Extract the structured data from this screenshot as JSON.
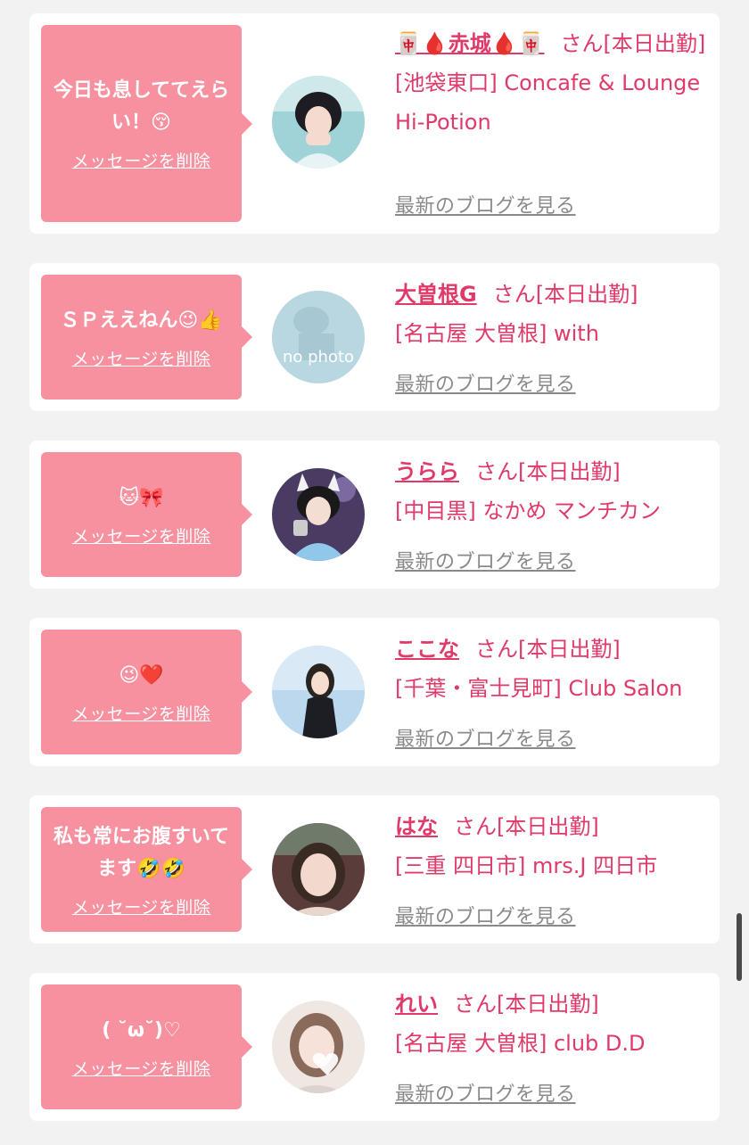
{
  "entries": [
    {
      "message": "今日も息しててえらい！😚",
      "delete_label": "メッセージを削除",
      "name": "🀄🩸赤城🩸🀄",
      "san": "さん",
      "status": "[本日出勤]",
      "shop": "[池袋東口] Concafe & Lounge Hi-Potion",
      "blog_label": "最新のブログを見る"
    },
    {
      "message": "ＳＰええねん😉👍",
      "delete_label": "メッセージを削除",
      "name": "大曽根G",
      "san": "さん",
      "status": "[本日出勤]",
      "shop": "[名古屋 大曽根] with",
      "blog_label": "最新のブログを見る",
      "avatar_text": "no photo"
    },
    {
      "message": "🐱🎀",
      "delete_label": "メッセージを削除",
      "name": "うらら",
      "san": "さん",
      "status": "[本日出勤]",
      "shop": "[中目黒] なかめ マンチカン",
      "blog_label": "最新のブログを見る"
    },
    {
      "message": "😉❤️",
      "delete_label": "メッセージを削除",
      "name": "ここな",
      "san": "さん",
      "status": "[本日出勤]",
      "shop": "[千葉・富士見町] Club Salon",
      "blog_label": "最新のブログを見る"
    },
    {
      "message": "私も常にお腹すいてます🤣🤣",
      "delete_label": "メッセージを削除",
      "name": "はな",
      "san": "さん",
      "status": "[本日出勤]",
      "shop": "[三重 四日市] mrs.J 四日市",
      "blog_label": "最新のブログを見る"
    },
    {
      "message": "( ˘ω˘)♡",
      "delete_label": "メッセージを削除",
      "name": "れい",
      "san": "さん",
      "status": "[本日出勤]",
      "shop": "[名古屋 大曽根] club D.D",
      "blog_label": "最新のブログを見る"
    }
  ],
  "colors": {
    "accent": "#e03a69",
    "bubble": "#f7909f",
    "background": "#f2f2f2",
    "muted": "#8a8a8a"
  },
  "icons": [
    "profile-photo",
    "no-photo-placeholder",
    "scrollbar"
  ]
}
